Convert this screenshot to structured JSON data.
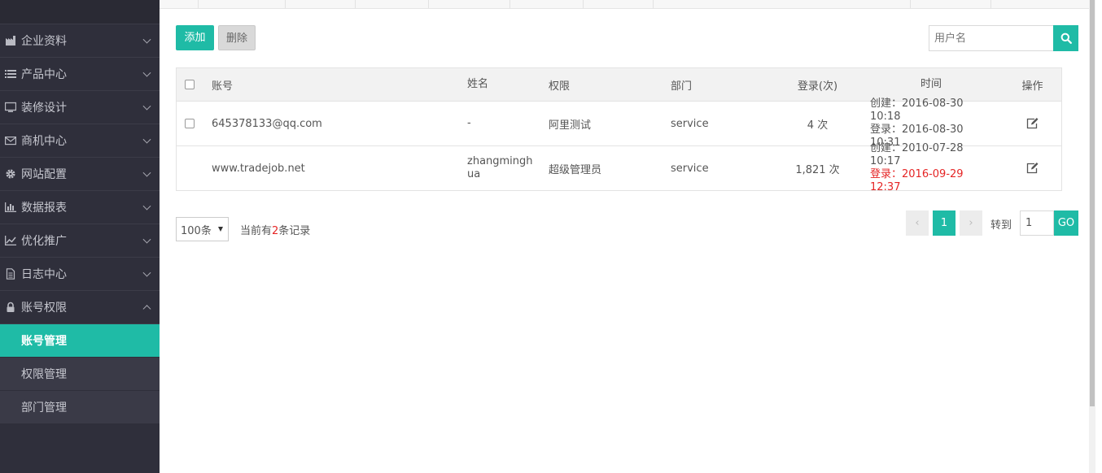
{
  "sidebar": {
    "menu": [
      {
        "label": "企业资料",
        "icon": "factory-icon"
      },
      {
        "label": "产品中心",
        "icon": "list-icon"
      },
      {
        "label": "装修设计",
        "icon": "monitor-icon"
      },
      {
        "label": "商机中心",
        "icon": "envelope-icon"
      },
      {
        "label": "网站配置",
        "icon": "gear-icon"
      },
      {
        "label": "数据报表",
        "icon": "bar-chart-icon"
      },
      {
        "label": "优化推广",
        "icon": "line-chart-icon"
      },
      {
        "label": "日志中心",
        "icon": "document-icon"
      },
      {
        "label": "账号权限",
        "icon": "lock-icon"
      }
    ],
    "submenu": [
      {
        "label": "账号管理",
        "active": true
      },
      {
        "label": "权限管理",
        "active": false
      },
      {
        "label": "部门管理",
        "active": false
      }
    ]
  },
  "toolbar": {
    "add_label": "添加",
    "delete_label": "删除",
    "search_placeholder": "用户名"
  },
  "table": {
    "headers": {
      "account": "账号",
      "name": "姓名",
      "permission": "权限",
      "department": "部门",
      "login_count": "登录(次)",
      "time": "时间",
      "action": "操作"
    },
    "rows": [
      {
        "account": "645378133@qq.com",
        "name": "-",
        "permission": "阿里测试",
        "department": "service",
        "login_count": "4 次",
        "created": "创建：2016-08-30 10:18",
        "last_login": "登录：2016-08-30 10:31",
        "has_checkbox": true
      },
      {
        "account": "www.tradejob.net",
        "name": "zhangminghua",
        "permission": "超级管理员",
        "department": "service",
        "login_count": "1,821 次",
        "created": "创建：2010-07-28 10:17",
        "last_login": "登录：2016-09-29 12:37",
        "has_checkbox": false
      }
    ]
  },
  "pagination": {
    "page_size": "100条",
    "record_prefix": "当前有",
    "record_count": "2",
    "record_suffix": "条记录",
    "prev": "‹",
    "current_page": "1",
    "next": "›",
    "goto_label": "转到",
    "goto_value": "1",
    "go_label": "GO"
  },
  "colors": {
    "accent": "#1fbba6",
    "sidebar_bg": "#2f2f3b",
    "highlight_red": "#e52525"
  }
}
